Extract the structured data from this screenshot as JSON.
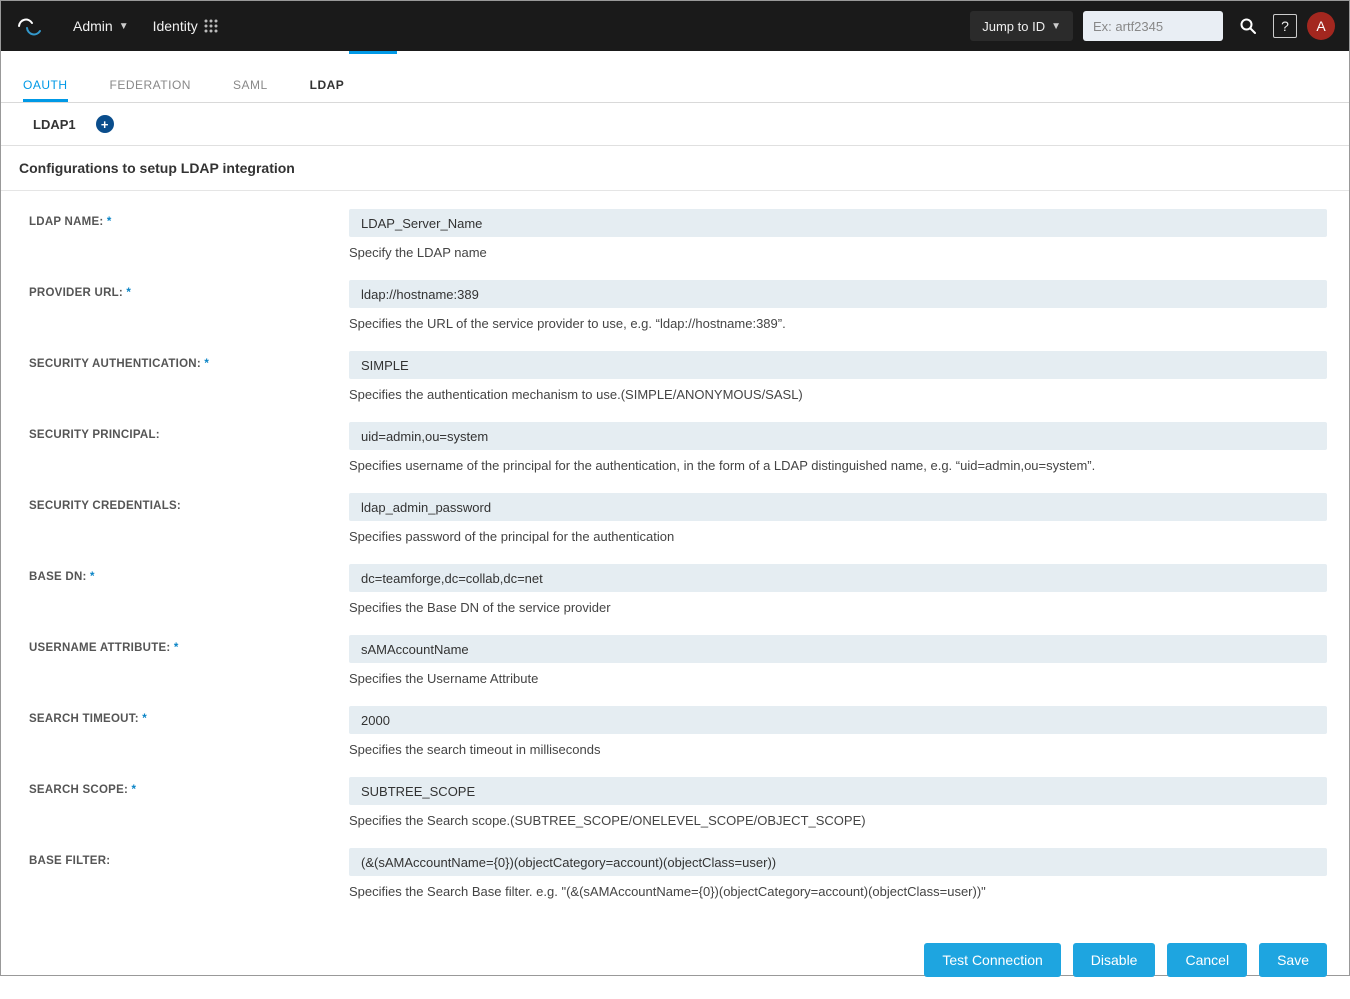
{
  "header": {
    "admin_label": "Admin",
    "identity_label": "Identity",
    "jump_label": "Jump to ID",
    "search_placeholder": "Ex: artf2345",
    "help_char": "?",
    "avatar_char": "A"
  },
  "tabs": {
    "oauth": "OAUTH",
    "federation": "FEDERATION",
    "saml": "SAML",
    "ldap": "LDAP"
  },
  "subtabs": {
    "ldap1": "LDAP1"
  },
  "section_title": "Configurations to setup LDAP integration",
  "fields": [
    {
      "label": "LDAP NAME:",
      "required": true,
      "value": "LDAP_Server_Name",
      "help": "Specify the LDAP name"
    },
    {
      "label": "PROVIDER URL:",
      "required": true,
      "value": "ldap://hostname:389",
      "help": "Specifies the URL of the service provider to use, e.g. “ldap://hostname:389”."
    },
    {
      "label": "SECURITY AUTHENTICATION:",
      "required": true,
      "value": "SIMPLE",
      "help": "Specifies the authentication mechanism to use.(SIMPLE/ANONYMOUS/SASL)"
    },
    {
      "label": "SECURITY PRINCIPAL:",
      "required": false,
      "value": "uid=admin,ou=system",
      "help": "Specifies username of the principal for the authentication, in the form of a LDAP distinguished name, e.g. “uid=admin,ou=system”."
    },
    {
      "label": "SECURITY CREDENTIALS:",
      "required": false,
      "value": "ldap_admin_password",
      "help": "Specifies password of the principal for the authentication"
    },
    {
      "label": "BASE DN:",
      "required": true,
      "value": "dc=teamforge,dc=collab,dc=net",
      "help": "Specifies the Base DN of the service provider"
    },
    {
      "label": "USERNAME ATTRIBUTE:",
      "required": true,
      "value": "sAMAccountName",
      "help": "Specifies the Username Attribute"
    },
    {
      "label": "SEARCH TIMEOUT:",
      "required": true,
      "value": "2000",
      "help": "Specifies the search timeout in milliseconds"
    },
    {
      "label": "SEARCH SCOPE:",
      "required": true,
      "value": "SUBTREE_SCOPE",
      "help": "Specifies the Search scope.(SUBTREE_SCOPE/ONELEVEL_SCOPE/OBJECT_SCOPE)"
    },
    {
      "label": "BASE FILTER:",
      "required": false,
      "value": "(&(sAMAccountName={0})(objectCategory=account)(objectClass=user))",
      "help": "Specifies the Search Base filter. e.g. \"(&(sAMAccountName={0})(objectCategory=account)(objectClass=user))\""
    }
  ],
  "buttons": {
    "test": "Test Connection",
    "disable": "Disable",
    "cancel": "Cancel",
    "save": "Save"
  }
}
